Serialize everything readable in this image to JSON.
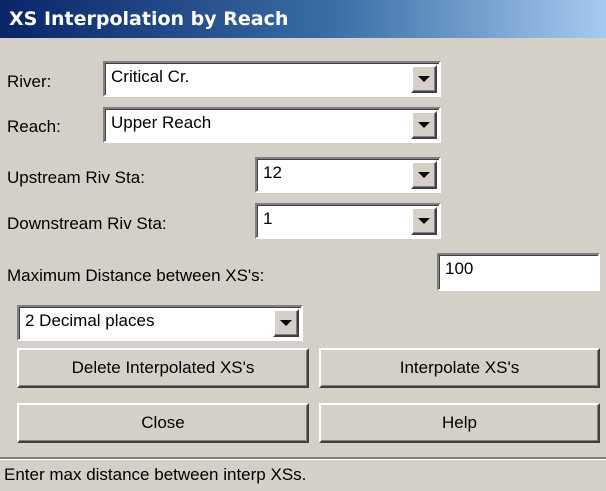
{
  "window": {
    "title": "XS Interpolation by Reach"
  },
  "river": {
    "label": "River:",
    "value": "Critical Cr."
  },
  "reach": {
    "label": "Reach:",
    "value": "Upper Reach"
  },
  "upstream": {
    "label": "Upstream Riv Sta:",
    "value": "12"
  },
  "downstream": {
    "label": "Downstream Riv Sta:",
    "value": "1"
  },
  "max_distance": {
    "label": "Maximum  Distance  between XS's:",
    "value": "100"
  },
  "decimal": {
    "value": "2 Decimal places"
  },
  "buttons": {
    "delete": "Delete Interpolated  XS's",
    "interpolate": "Interpolate XS's",
    "close": "Close",
    "help": "Help"
  },
  "status": {
    "text": "Enter max distance between interp XSs."
  }
}
